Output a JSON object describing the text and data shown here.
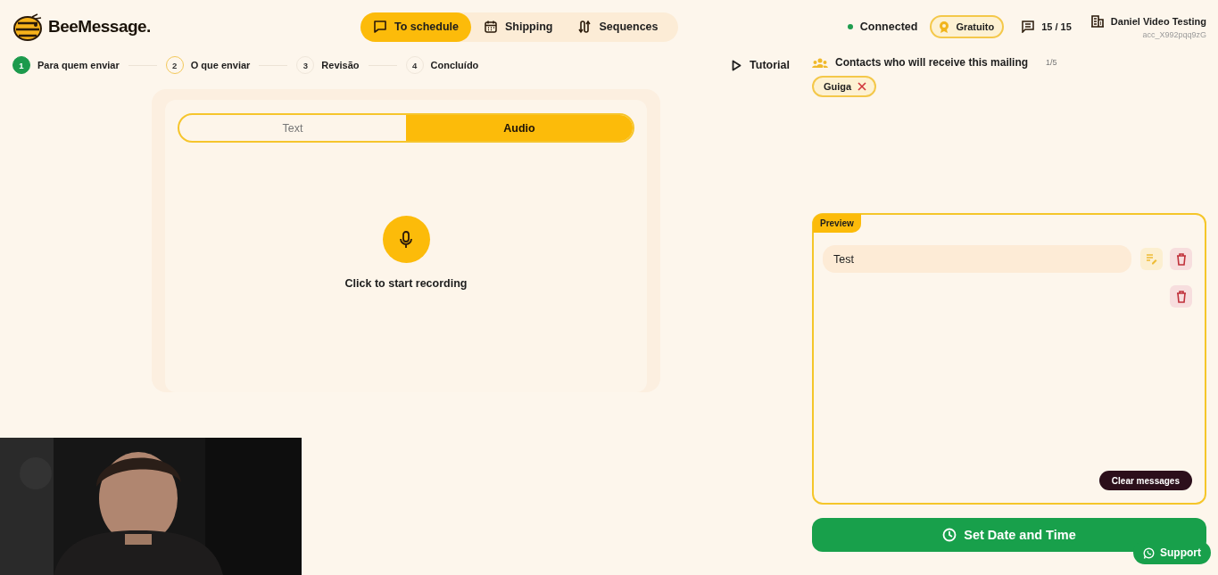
{
  "brand": {
    "name": "BeeMessage."
  },
  "nav": [
    {
      "label": "To schedule",
      "selected": true
    },
    {
      "label": "Shipping",
      "selected": false
    },
    {
      "label": "Sequences",
      "selected": false
    }
  ],
  "status": {
    "connection": "Connected",
    "connected": true,
    "plan": "Gratuito",
    "credits": "15 / 15",
    "account_name": "Daniel Video Testing",
    "account_id": "acc_X992pqq9zG"
  },
  "steps": [
    {
      "number": "1",
      "label": "Para quem enviar",
      "completed": true,
      "selected": false
    },
    {
      "number": "2",
      "label": "O que enviar",
      "completed": false,
      "selected": true
    },
    {
      "number": "3",
      "label": "Revisão",
      "completed": false,
      "selected": false
    },
    {
      "number": "4",
      "label": "Concluído",
      "completed": false,
      "selected": false
    }
  ],
  "tutorial": "Tutorial",
  "composer": {
    "tabs": [
      {
        "label": "Text",
        "selected": false
      },
      {
        "label": "Audio",
        "selected": true
      }
    ],
    "record_hint": "Click to start recording"
  },
  "recipients": {
    "title": "Contacts who will receive this mailing",
    "count": "1/5",
    "contacts": [
      {
        "name": "Guiga"
      }
    ]
  },
  "preview": {
    "label": "Preview",
    "messages": [
      {
        "kind": "text",
        "text": "Test"
      },
      {
        "kind": "blank"
      }
    ],
    "clear_button": "Clear messages"
  },
  "schedule_button": "Set Date and Time",
  "support_button": "Support"
}
